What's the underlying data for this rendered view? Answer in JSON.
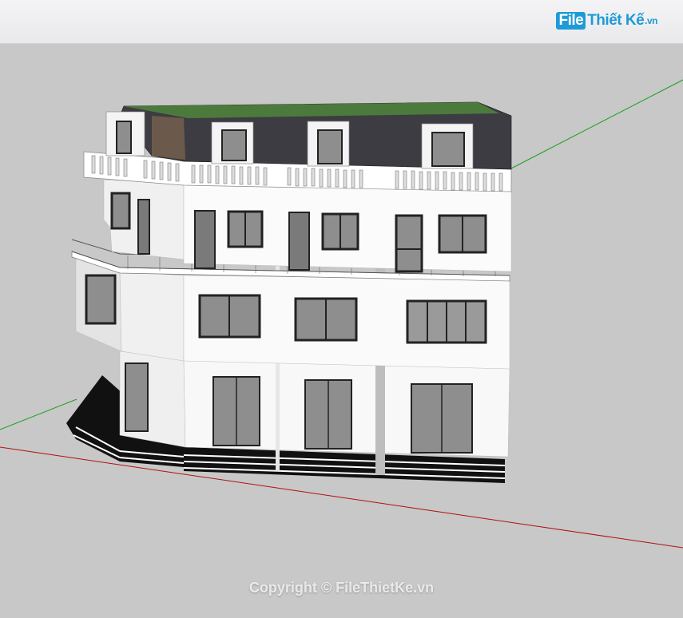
{
  "header": {
    "logo": {
      "file": "File",
      "name": "Thiết Kế",
      "tld": ".vn",
      "brand_color": "#1e9bd6"
    }
  },
  "viewport": {
    "background_color": "#c8c8c8",
    "axes": {
      "green_axis_color": "#1aa01a",
      "red_axis_color": "#b01010"
    },
    "model": {
      "description_icon": "townhouse-3d-model",
      "roof_color": "#3c3c42",
      "wall_color": "#f6f6f6",
      "glass_color": "#8e8e8e"
    }
  },
  "watermark": {
    "text": "Copyright © FileThietKe.vn"
  }
}
